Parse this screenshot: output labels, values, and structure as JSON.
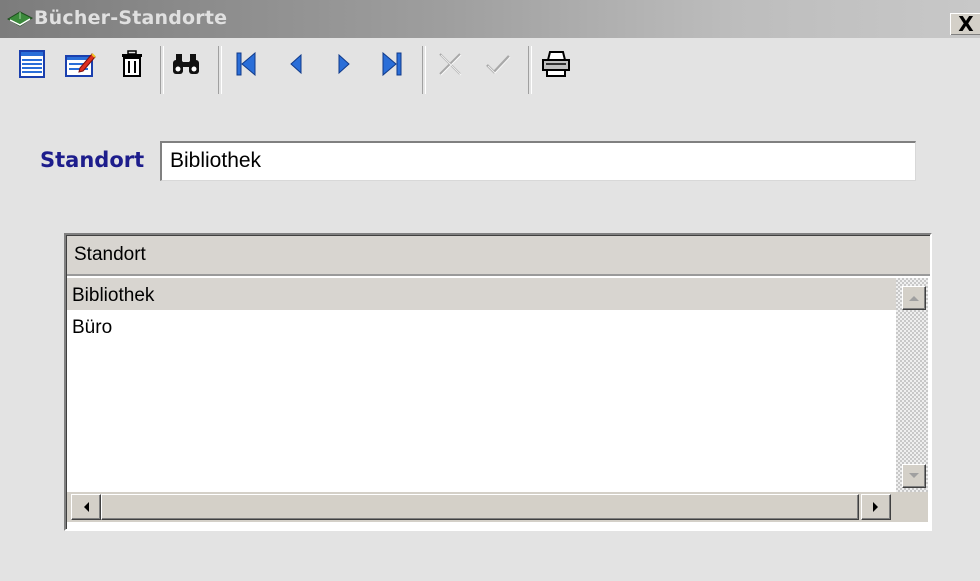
{
  "window": {
    "title": "Bücher-Standorte",
    "close_symbol": "X"
  },
  "toolbar": {
    "buttons": [
      {
        "name": "list-icon"
      },
      {
        "name": "edit-icon"
      },
      {
        "name": "trash-icon"
      },
      {
        "name": "binoculars-icon"
      },
      {
        "name": "first-record-icon"
      },
      {
        "name": "previous-record-icon"
      },
      {
        "name": "next-record-icon"
      },
      {
        "name": "last-record-icon"
      },
      {
        "name": "cancel-icon",
        "disabled": true
      },
      {
        "name": "confirm-icon",
        "disabled": true
      },
      {
        "name": "printer-icon"
      }
    ]
  },
  "form": {
    "standort_label": "Standort",
    "standort_value": "Bibliothek"
  },
  "grid": {
    "column_header": "Standort",
    "rows": [
      "Bibliothek",
      "Büro"
    ],
    "selected_row": 0
  },
  "colors": {
    "label": "#1d1d8c",
    "background": "#e3e3e3",
    "accent_icon": "#2a6ed8"
  }
}
